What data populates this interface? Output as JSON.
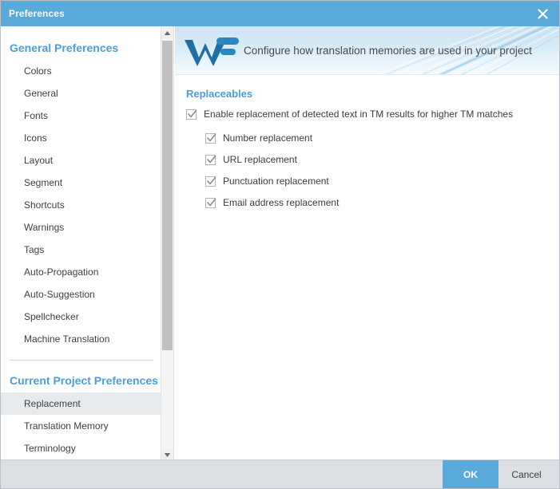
{
  "window": {
    "title": "Preferences",
    "close_icon": "close-icon"
  },
  "colors": {
    "title_bar": "#5aa9db",
    "accent_blue": "#4d9ed6",
    "ok_button": "#5aa9db",
    "logo_blue": "#1f6ea8",
    "selected_row": "#e7ebee",
    "footer": "#dcdfe3"
  },
  "sidebar": {
    "groups": [
      {
        "title": "General Preferences",
        "items": [
          {
            "label": "Colors",
            "selected": false
          },
          {
            "label": "General",
            "selected": false
          },
          {
            "label": "Fonts",
            "selected": false
          },
          {
            "label": "Icons",
            "selected": false
          },
          {
            "label": "Layout",
            "selected": false
          },
          {
            "label": "Segment",
            "selected": false
          },
          {
            "label": "Shortcuts",
            "selected": false
          },
          {
            "label": "Warnings",
            "selected": false
          },
          {
            "label": "Tags",
            "selected": false
          },
          {
            "label": "Auto-Propagation",
            "selected": false
          },
          {
            "label": "Auto-Suggestion",
            "selected": false
          },
          {
            "label": "Spellchecker",
            "selected": false
          },
          {
            "label": "Machine Translation",
            "selected": false
          }
        ]
      },
      {
        "title": "Current Project Preferences",
        "items": [
          {
            "label": "Replacement",
            "selected": true
          },
          {
            "label": "Translation Memory",
            "selected": false
          },
          {
            "label": "Terminology",
            "selected": false
          }
        ]
      }
    ],
    "scrollbar": {
      "up_arrow_icon": "scroll-up-arrow-icon",
      "down_arrow_icon": "scroll-down-arrow-icon"
    }
  },
  "main": {
    "banner": {
      "logo_icon": "wordfast-logo-icon",
      "text": "Configure how translation memories are used in your project"
    },
    "section": {
      "title": "Replaceables",
      "master_option": {
        "label": "Enable replacement of detected text in TM results for higher TM matches",
        "checked": true
      },
      "options": [
        {
          "label": "Number replacement",
          "checked": true
        },
        {
          "label": "URL replacement",
          "checked": true
        },
        {
          "label": "Punctuation replacement",
          "checked": true
        },
        {
          "label": "Email address replacement",
          "checked": true
        }
      ]
    }
  },
  "footer": {
    "ok_label": "OK",
    "cancel_label": "Cancel"
  }
}
